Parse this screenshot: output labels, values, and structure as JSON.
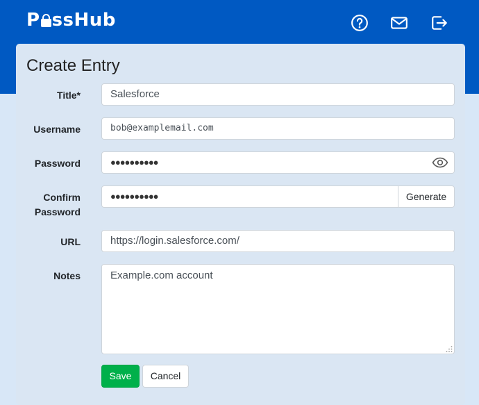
{
  "header": {
    "logo_prefix": "P",
    "logo_suffix": "ssHub",
    "icons": [
      "help-icon",
      "mail-icon",
      "logout-icon"
    ]
  },
  "form": {
    "title": "Create Entry",
    "fields": {
      "title": {
        "label": "Title*",
        "value": "Salesforce"
      },
      "username": {
        "label": "Username",
        "value": "bob@examplemail.com"
      },
      "password": {
        "label": "Password",
        "value": "●●●●●●●●●●"
      },
      "confirm": {
        "label_line1": "Confirm",
        "label_line2": "Password",
        "value": "●●●●●●●●●●"
      },
      "url": {
        "label": "URL",
        "value": "https://login.salesforce.com/"
      },
      "notes": {
        "label": "Notes",
        "value": "Example.com account"
      }
    },
    "generate_label": "Generate",
    "save_label": "Save",
    "cancel_label": "Cancel"
  },
  "colors": {
    "brand": "#0059c2",
    "background": "#d8e7f7",
    "save": "#00b04a"
  }
}
